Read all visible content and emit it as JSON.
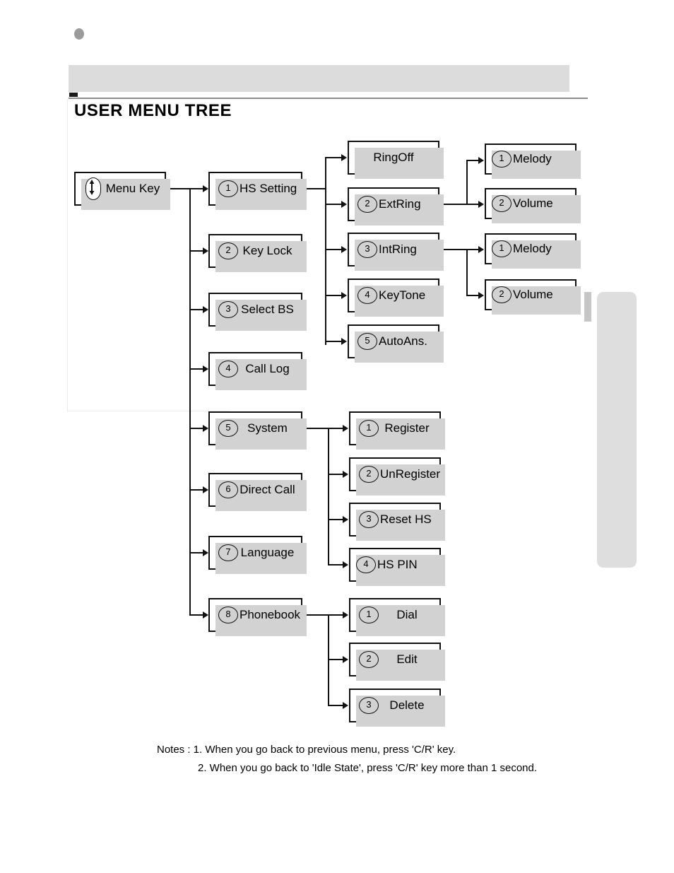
{
  "page": {
    "title": "USER MENU TREE",
    "bullet": "bullet-dot"
  },
  "root": {
    "label": "Menu Key",
    "icon": "navigation-key-icon"
  },
  "level1": [
    {
      "num": "1",
      "label": "HS Setting"
    },
    {
      "num": "2",
      "label": "Key Lock"
    },
    {
      "num": "3",
      "label": "Select BS"
    },
    {
      "num": "4",
      "label": "Call Log"
    },
    {
      "num": "5",
      "label": "System"
    },
    {
      "num": "6",
      "label": "Direct Call"
    },
    {
      "num": "7",
      "label": "Language"
    },
    {
      "num": "8",
      "label": "Phonebook"
    }
  ],
  "hs_setting_children": [
    {
      "num": "",
      "label": "RingOff"
    },
    {
      "num": "2",
      "label": "ExtRing"
    },
    {
      "num": "3",
      "label": "IntRing"
    },
    {
      "num": "4",
      "label": "KeyTone"
    },
    {
      "num": "5",
      "label": "AutoAns."
    }
  ],
  "ext_ring_children": [
    {
      "num": "1",
      "label": "Melody"
    },
    {
      "num": "2",
      "label": "Volume"
    }
  ],
  "int_ring_children": [
    {
      "num": "1",
      "label": "Melody"
    },
    {
      "num": "2",
      "label": "Volume"
    }
  ],
  "system_children": [
    {
      "num": "1",
      "label": "Register"
    },
    {
      "num": "2",
      "label": "UnRegister"
    },
    {
      "num": "3",
      "label": "Reset HS"
    },
    {
      "num": "4",
      "label": "HS PIN"
    }
  ],
  "phonebook_children": [
    {
      "num": "1",
      "label": "Dial"
    },
    {
      "num": "2",
      "label": "Edit"
    },
    {
      "num": "3",
      "label": "Delete"
    }
  ],
  "notes": {
    "line1": "Notes : 1. When you go back to previous menu, press  'C/R' key.",
    "line2": "2. When you go back to 'Idle State', press 'C/R' key more than 1 second."
  },
  "colors": {
    "shadow": "#d2d2d2",
    "line": "#111111",
    "header_bar": "#dcdcdc",
    "thumb_tab": "#dedede"
  }
}
